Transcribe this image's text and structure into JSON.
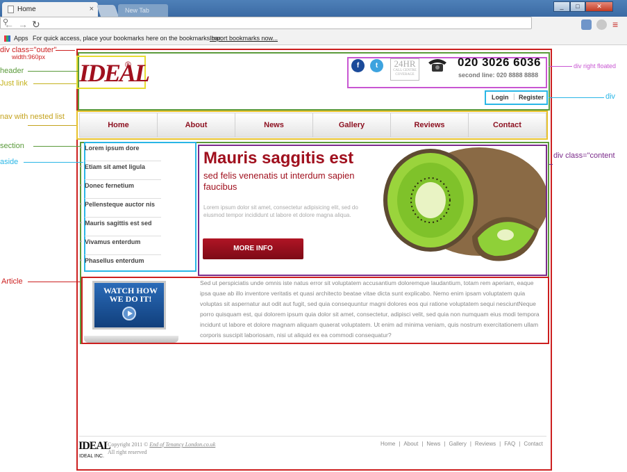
{
  "browser": {
    "tab_title": "Home",
    "tab_close": "×",
    "bg_tab_title": "New Tab",
    "window_buttons": [
      "_",
      "□",
      "✕"
    ],
    "bookmarks_apps": "Apps",
    "bookmarks_hint": "For quick access, place your bookmarks here on the bookmarks bar.",
    "bookmarks_import": "Import bookmarks now..."
  },
  "site": {
    "logo": "IDEAL",
    "logo_reg": "®",
    "social": [
      "f",
      "t"
    ],
    "badge_24": "24HR",
    "badge_24_sub": "CALL CENTRE COVERAGE",
    "phone": "020 3026 6036",
    "phone_second": "second line: 020 8888 8888",
    "login": "Login",
    "register": "Register",
    "separator": "|",
    "nav": [
      "Home",
      "About",
      "News",
      "Gallery",
      "Reviews",
      "Contact"
    ],
    "aside": [
      "Lorem ipsum dore",
      "Etiam sit amet ligula",
      "Donec fernetium",
      "Pellensteque auctor nis",
      "Mauris sagittis est sed",
      "Vivamus enterdum",
      "Phasellus enterdum"
    ],
    "hero_title": "Mauris saggitis est",
    "hero_sub": "sed felis venenatis ut interdum sapien faucibus",
    "hero_body": "Lorem ipsum dolor sit amet, consectetur adipisicing elit, sed do eiusmod tempor incididunt ut labore et dolore magna aliqua.",
    "more_info": "MORE INFO",
    "video_title": "WATCH HOW WE DO IT!",
    "article_text": "Sed ut perspiciatis unde omnis iste natus error sit voluptatem accusantium doloremque laudantium, totam rem aperiam, eaque ipsa quae ab illo inventore veritatis et quasi architecto beatae vitae dicta sunt explicabo. Nemo enim ipsam voluptatem quia voluptas sit aspernatur aut odit aut fugit, sed quia consequuntur magni dolores eos qui ratione voluptatem sequi nesciuntNeque porro quisquam est, qui dolorem ipsum quia dolor sit amet, consectetur, adipisci velit, sed quia non numquam eius modi tempora incidunt ut labore et dolore magnam aliquam quaerat voluptatem. Ut enim ad minima veniam, quis nostrum exercitationem ullam corporis suscipit laboriosam, nisi ut aliquid ex ea commodi consequatur?",
    "footer_logo": "IDEAL",
    "footer_inc": "IDEAL INC.",
    "footer_copyright": "Copyright 2011 ©",
    "footer_link": "End of Tenancy London.co.uk",
    "footer_rights": "All right reserved",
    "footer_links": [
      "Home",
      "About",
      "News",
      "Gallery",
      "Reviews",
      "FAQ",
      "Contact"
    ]
  },
  "annotations": {
    "outer": "div class=\"outer\"",
    "outer_width": "width:960px",
    "header": "header",
    "just_link": "Just link",
    "nav": "nav with nested list",
    "section": "section",
    "aside": "aside",
    "article": "Article",
    "right_floated": "div right floated",
    "div": "div",
    "content": "div class=\"content"
  },
  "colors": {
    "outer": "#cc1f1f",
    "header": "#5a9a3a",
    "link": "#e8dc30",
    "nav": "#e8c22b",
    "aside": "#29b6e6",
    "right": "#c856d2",
    "content": "#7a2a8a",
    "brand": "#a0101e"
  }
}
